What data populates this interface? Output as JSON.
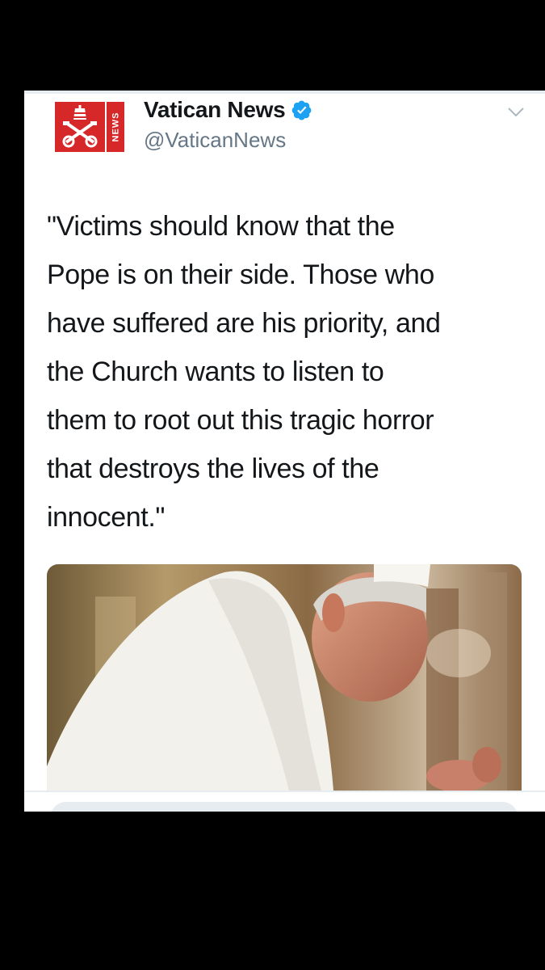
{
  "tweet": {
    "author": {
      "display_name": "Vatican News",
      "handle": "@VaticanNews",
      "verified": true,
      "avatar_badge_text": "NEWS",
      "avatar_color": "#d62828"
    },
    "text": "\"Victims should know that the\nPope is on their side. Those who\nhave suffered are his priority, and\nthe Church wants to listen to\nthem to root out this tragic horror\nthat destroys the lives of the\ninnocent.\"",
    "menu_icon": "chevron-down-icon",
    "verified_icon": "verified-badge-icon",
    "verified_color": "#1da1f2"
  }
}
